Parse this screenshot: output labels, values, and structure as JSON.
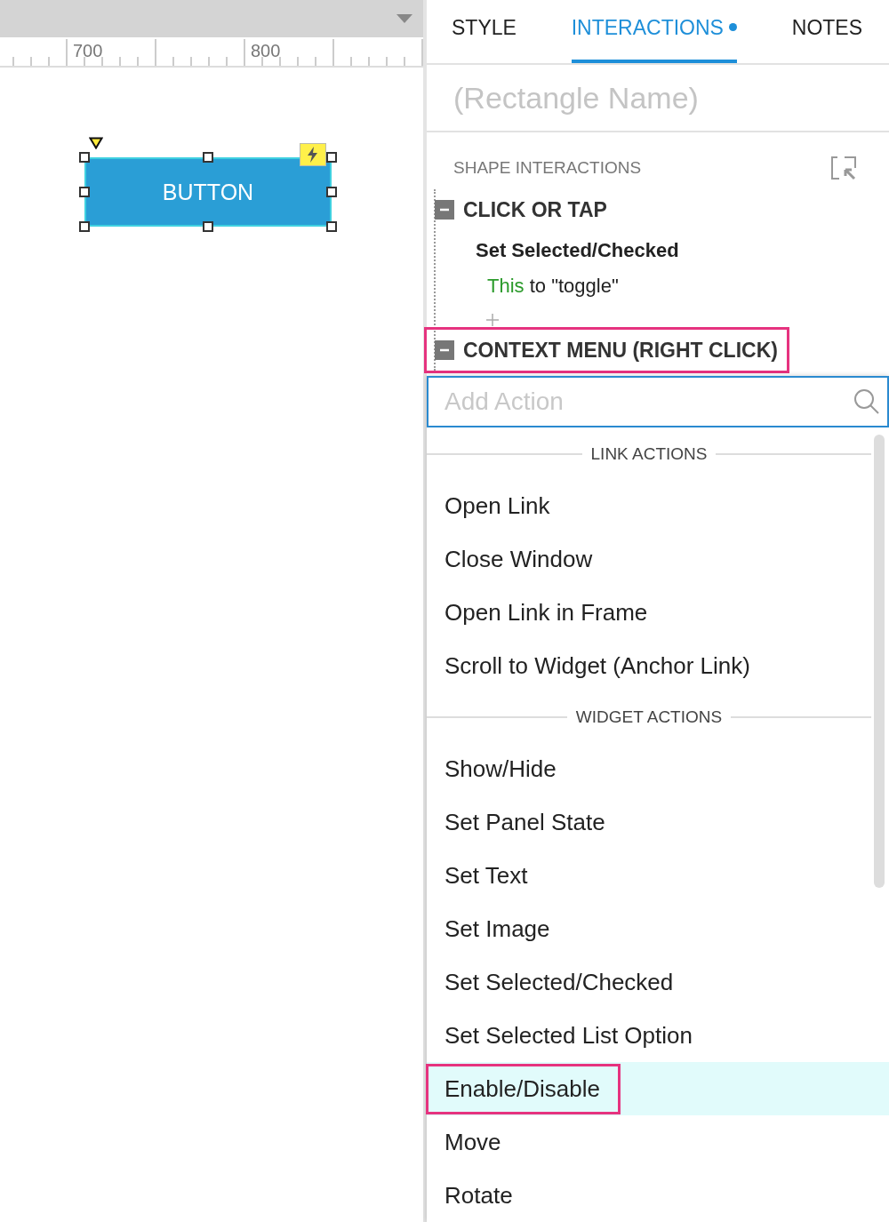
{
  "canvas": {
    "ruler_labels": [
      "700",
      "800"
    ],
    "widget": {
      "label": "BUTTON",
      "selected": true,
      "has_interactions": true
    }
  },
  "panel": {
    "tabs": [
      {
        "label": "STYLE",
        "selected": false,
        "badge": false
      },
      {
        "label": "INTERACTIONS",
        "selected": true,
        "badge": true
      },
      {
        "label": "NOTES",
        "selected": false,
        "badge": false
      }
    ],
    "name_field": {
      "placeholder": "(Rectangle Name)"
    },
    "section_title": "SHAPE INTERACTIONS",
    "events": [
      {
        "title": "CLICK OR TAP",
        "expanded": true,
        "highlighted": false,
        "actions": [
          {
            "name": "Set Selected/Checked",
            "target": "This",
            "detail": " to \"toggle\""
          }
        ]
      },
      {
        "title": "CONTEXT MENU (RIGHT CLICK)",
        "expanded": true,
        "highlighted": true
      }
    ],
    "action_picker": {
      "placeholder": "Add Action",
      "items": [
        {
          "kind": "header",
          "label": "LINK ACTIONS"
        },
        {
          "kind": "action",
          "label": "Open Link",
          "selected": false,
          "highlighted": false
        },
        {
          "kind": "action",
          "label": "Close Window",
          "selected": false,
          "highlighted": false
        },
        {
          "kind": "action",
          "label": "Open Link in Frame",
          "selected": false,
          "highlighted": false
        },
        {
          "kind": "action",
          "label": "Scroll to Widget (Anchor Link)",
          "selected": false,
          "highlighted": false
        },
        {
          "kind": "header",
          "label": "WIDGET ACTIONS"
        },
        {
          "kind": "action",
          "label": "Show/Hide",
          "selected": false,
          "highlighted": false
        },
        {
          "kind": "action",
          "label": "Set Panel State",
          "selected": false,
          "highlighted": false
        },
        {
          "kind": "action",
          "label": "Set Text",
          "selected": false,
          "highlighted": false
        },
        {
          "kind": "action",
          "label": "Set Image",
          "selected": false,
          "highlighted": false
        },
        {
          "kind": "action",
          "label": "Set Selected/Checked",
          "selected": false,
          "highlighted": false
        },
        {
          "kind": "action",
          "label": "Set Selected List Option",
          "selected": false,
          "highlighted": false
        },
        {
          "kind": "action",
          "label": "Enable/Disable",
          "selected": true,
          "highlighted": true
        },
        {
          "kind": "action",
          "label": "Move",
          "selected": false,
          "highlighted": false
        },
        {
          "kind": "action",
          "label": "Rotate",
          "selected": false,
          "highlighted": false
        }
      ]
    }
  }
}
